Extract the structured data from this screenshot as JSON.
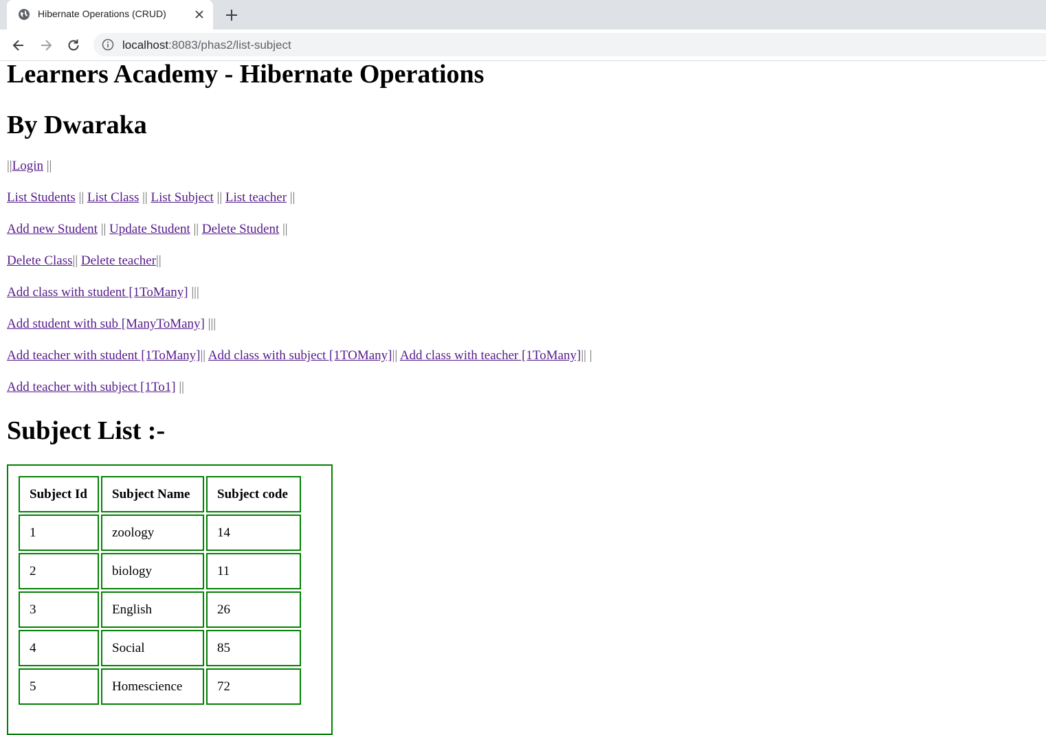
{
  "browser": {
    "tab_title": "Hibernate Operations (CRUD)",
    "url_host": "localhost",
    "url_rest": ":8083/phas2/list-subject"
  },
  "page": {
    "title": "Learners Academy - Hibernate Operations",
    "author": "By Dwaraka",
    "login_prefix": "||",
    "login_link": "Login",
    "login_suffix": " ||",
    "nav_row2": {
      "list_students": "List Students",
      "list_class": "List Class",
      "list_subject": "List Subject",
      "list_teacher": "List teacher",
      "sep": " || ",
      "end": " ||"
    },
    "nav_row3": {
      "add_student": "Add new Student",
      "update_student": "Update Student",
      "delete_student": "Delete Student",
      "sep": " || ",
      "end": " ||"
    },
    "nav_row4": {
      "delete_class": "Delete Class",
      "delete_teacher": "Delete teacher",
      "sep1": "|| ",
      "end": "||"
    },
    "nav_row5": {
      "link": "Add class with student [1ToMany]",
      "end": " |||"
    },
    "nav_row6": {
      "link": "Add student with sub [ManyToMany]",
      "end": " |||"
    },
    "nav_row7": {
      "teacher_student": "Add teacher with student [1ToMany]",
      "class_subject": "Add class with subject [1TOMany]",
      "class_teacher": "Add class with teacher [1ToMany]",
      "sep": "|| ",
      "end": "|| |"
    },
    "nav_row8": {
      "link": "Add teacher with subject [1To1]",
      "end": " ||"
    },
    "subject_heading": "Subject List :-"
  },
  "table": {
    "headers": [
      "Subject Id",
      "Subject Name",
      "Subject code"
    ],
    "rows": [
      [
        "1",
        "zoology",
        "14"
      ],
      [
        "2",
        "biology",
        "11"
      ],
      [
        "3",
        "English",
        "26"
      ],
      [
        "4",
        "Social",
        "85"
      ],
      [
        "5",
        "Homescience",
        "72"
      ]
    ]
  },
  "icons": {
    "favicon": "globe-icon",
    "close": "close-icon",
    "new_tab": "plus-icon",
    "back": "arrow-left-icon",
    "forward": "arrow-right-icon",
    "reload": "reload-icon",
    "site_info": "info-icon"
  }
}
